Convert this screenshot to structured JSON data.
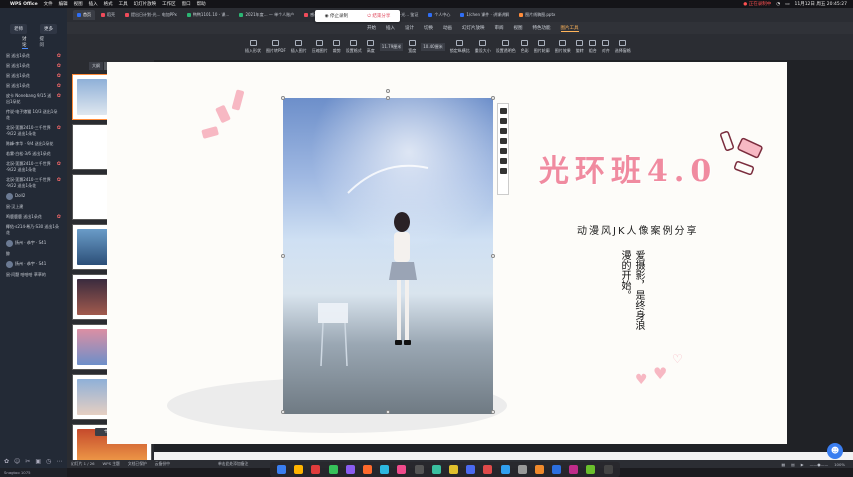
{
  "menubar": {
    "app_name": "WPS Office",
    "items": [
      "文件",
      "编辑",
      "视图",
      "插入",
      "格式",
      "工具",
      "幻灯片放映",
      "工作区",
      "窗口",
      "帮助"
    ],
    "recording": "● 正在录制中",
    "datetime": "11月12日 周五 20:45:27"
  },
  "chat": {
    "tabs": [
      "老师",
      "更多"
    ],
    "sub_tabs": [
      "讨论",
      "提问"
    ],
    "messages": [
      {
        "text": "鼠 送出1朵花",
        "star": true
      },
      {
        "text": "鼠 送出1朵花",
        "star": true
      },
      {
        "text": "鼠 送出1朵花",
        "star": true
      },
      {
        "text": "鼠 送出1朵花",
        "star": true
      },
      {
        "text": "皮卡 Nonebang 9/15 送出1朵花",
        "star": true
      },
      {
        "text": "传说·电子娘猫 10/3 送出1朵花",
        "star": false
      },
      {
        "text": "北溟·莲灏2410·三千世界·9/22 送出1朵花",
        "star": true
      },
      {
        "text": "陈峰·李华 · 9/4 送出1朵花",
        "star": false
      },
      {
        "text": "若雾·白松·3/6 送出1朵花",
        "star": false
      },
      {
        "text": "北溟·莲灏2410·三千世界·9/22 送出1朵花",
        "star": true
      },
      {
        "text": "北溟·莲灏2410·三千世界·9/22 送出1朵花",
        "star": true
      },
      {
        "text": "Doll2",
        "star": false,
        "avatar": true
      },
      {
        "text": "鼠·汉上建",
        "star": false
      },
      {
        "text": "鸣鹿鹿鹿 送出1朵花",
        "star": true
      },
      {
        "text": "椰佑·s214·希乃·S30 送出1朵花",
        "star": false
      },
      {
        "text": "扬州 · 恭宇 · S41",
        "star": false,
        "avatar": true
      },
      {
        "text": "鲸",
        "star": false
      },
      {
        "text": "扬州 · 恭宇 · S41",
        "star": false,
        "avatar": true
      },
      {
        "text": "鼠·问题 哈哈哈 草草的",
        "star": false
      }
    ]
  },
  "tabs": [
    {
      "label": "首页",
      "color": "#2f6ef5",
      "active": true
    },
    {
      "label": "稻壳",
      "color": "#f04b5a"
    },
    {
      "label": "提出日计划-光… 电加PPx",
      "color": "#f04b5a"
    },
    {
      "label": "鸭鸭1101.10 - 课…",
      "color": "#2bb673"
    },
    {
      "label": "2021年度… — 单个人账户",
      "color": "#2bb673"
    },
    {
      "label": "感谢",
      "color": "#f04b5a"
    },
    {
      "label": "(草稿箱) 光… 鉴证",
      "color": "#2f6ef5"
    },
    {
      "label": "一套课程·光… 鉴证",
      "color": "#2f6ef5"
    },
    {
      "label": "个人中心",
      "color": "#2f6ef5"
    },
    {
      "label": "1/chen 课件 · 讲课讲解",
      "color": "#2f6ef5"
    },
    {
      "label": "图片线稿图.pptx",
      "color": "#ff8c3a"
    }
  ],
  "share": {
    "stop": "停止录制",
    "end": "结束分享"
  },
  "menu2": [
    "开始",
    "插入",
    "设计",
    "切换",
    "动画",
    "幻灯片放映",
    "审阅",
    "视图",
    "特色功能",
    "图片工具"
  ],
  "menu2_active": "图片工具",
  "ribbon": [
    "插入形状",
    "图片转PDF",
    "插入图片",
    "压缩图片",
    "裁剪",
    "设置格式",
    "高度",
    "宽度",
    "锁定纵横比",
    "重设大小",
    "设置透明色",
    "色彩",
    "图片轮廓",
    "图片效果",
    "旋转",
    "组合",
    "对齐",
    "选择窗格"
  ],
  "ribbon_values": {
    "height": "11.79厘米",
    "width": "10.40厘米"
  },
  "thumb_tabs": [
    "大纲",
    "幻灯片"
  ],
  "slides_count": 8,
  "slide": {
    "title": "光环班4.0",
    "subtitle": "动漫风JK人像案例分享",
    "vertical_1": "爱摄影，是终身浪",
    "vertical_2": "漫的开始。"
  },
  "status": {
    "left": [
      "幻灯片 1 / 26",
      "WPS 主题",
      "文档已保护",
      "云备份中"
    ],
    "notes": "单击此处添加备注",
    "zoom": "100%"
  },
  "colors": {
    "accent": "#ff8c3a",
    "pink": "#f08ba0",
    "ribbon": "#2b2d33"
  }
}
